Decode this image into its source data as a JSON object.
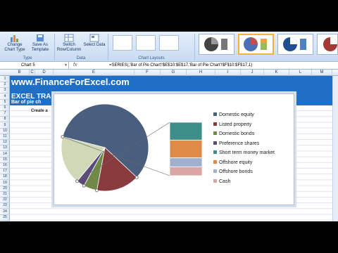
{
  "ribbon": {
    "buttons": [
      {
        "label": "Change Chart Type"
      },
      {
        "label": "Save As Template"
      },
      {
        "label": "Switch Row/Column"
      },
      {
        "label": "Select Data"
      }
    ],
    "groups": [
      "Type",
      "Data",
      "Chart Layouts"
    ]
  },
  "formula_bar": {
    "name_box": "Chart 5",
    "formula": "=SERIES(,'Bar of Pie Chart'!$E$10:$E$17,'Bar of Pie Chart'!$F$10:$F$17,1)"
  },
  "columns": [
    "B",
    "C",
    "D",
    "E",
    "F",
    "G",
    "H",
    "I",
    "J",
    "K",
    "L",
    "M"
  ],
  "rows": [
    "1",
    "2",
    "3",
    "4",
    "5",
    "6",
    "7",
    "8",
    "9",
    "10",
    "11",
    "12",
    "13",
    "14",
    "15",
    "16",
    "17",
    "18",
    "19",
    "20",
    "21",
    "22",
    "23",
    "24",
    "25"
  ],
  "sheet": {
    "banner_url": "www.FinanceForExcel.com",
    "banner_title": "EXCEL TRAINING",
    "banner_subtitle": "Bar of pie ch",
    "cell_text": "Create a"
  },
  "chart_data": {
    "type": "pie",
    "subtype": "bar-of-pie",
    "categories": [
      "Domestic equity",
      "Listed property",
      "Domestic bonds",
      "Preference shares",
      "Short term money market",
      "Offshore equity",
      "Offshore bonds",
      "Cash"
    ],
    "values": [
      58,
      16,
      5,
      3,
      6,
      6,
      3,
      3
    ],
    "colors": [
      "#4a5f7e",
      "#8a3b3e",
      "#6f8a47",
      "#5a4b7a",
      "#3e8f8a",
      "#df8a47",
      "#9fb1cf",
      "#d9a6a6"
    ],
    "legend_position": "right"
  }
}
